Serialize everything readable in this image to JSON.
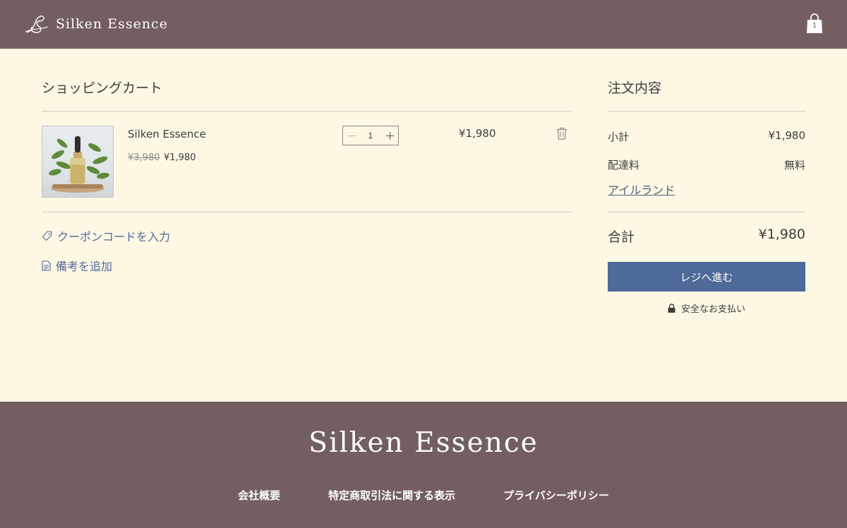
{
  "header": {
    "brand": "Silken Essence",
    "cart_count": "1"
  },
  "cart": {
    "title": "ショッピングカート",
    "items": [
      {
        "name": "Silken Essence",
        "original_price": "¥3,980",
        "price": "¥1,980",
        "quantity": "1",
        "line_total": "¥1,980",
        "image_icon": "serum-bottle-with-leaves"
      }
    ],
    "coupon_link": "クーポンコードを入力",
    "note_link": "備考を追加"
  },
  "summary": {
    "title": "注文内容",
    "subtotal_label": "小計",
    "subtotal_value": "¥1,980",
    "shipping_label": "配達料",
    "shipping_value": "無料",
    "region_link": "アイルランド",
    "total_label": "合計",
    "total_value": "¥1,980",
    "checkout_label": "レジへ進む",
    "secure_label": "安全なお支払い"
  },
  "footer": {
    "brand": "Silken Essence",
    "links": [
      "会社概要",
      "特定商取引法に関する表示",
      "プライバシーポリシー"
    ]
  },
  "colors": {
    "header_bg": "#735f60",
    "page_bg": "#fdf7e4",
    "accent": "#4e6a98"
  }
}
